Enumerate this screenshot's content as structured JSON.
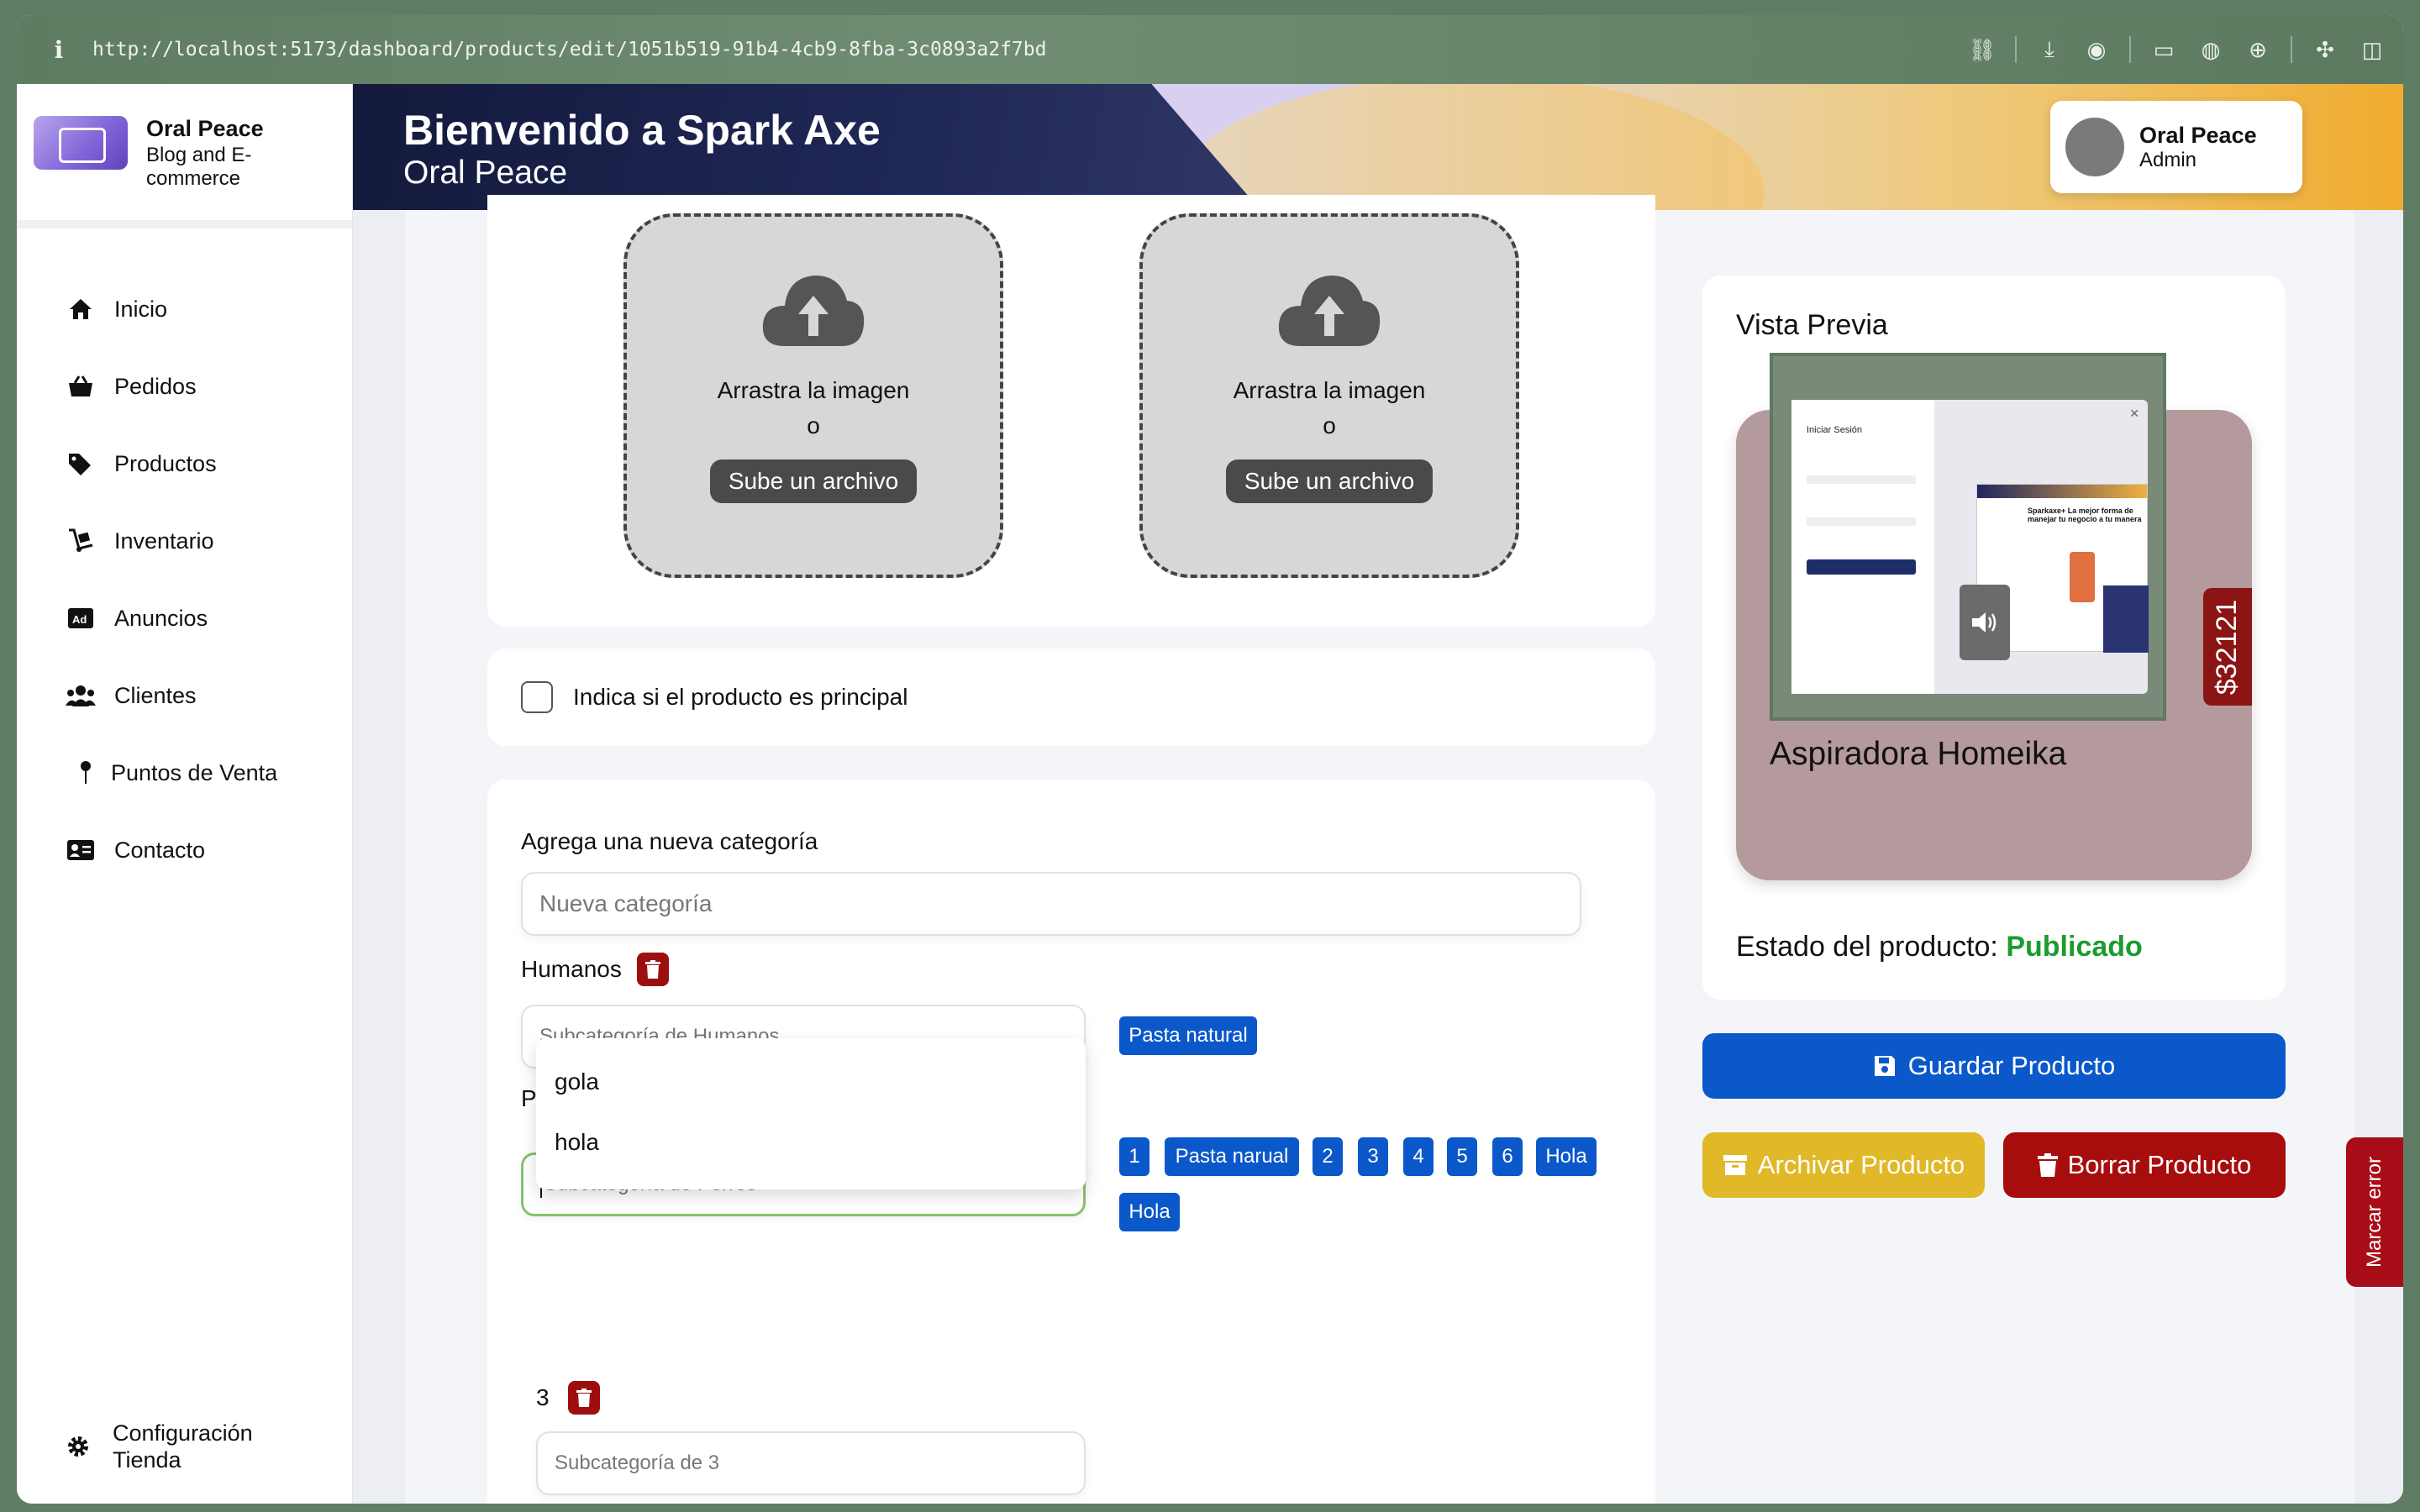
{
  "browser": {
    "url": "http://localhost:5173/dashboard/products/edit/1051b519-91b4-4cb9-8fba-3c0893a2f7bd"
  },
  "sidebar": {
    "brand_name": "Oral Peace",
    "brand_sub": "Blog and E-commerce",
    "items": [
      {
        "label": "Inicio",
        "icon": "home-icon"
      },
      {
        "label": "Pedidos",
        "icon": "basket-icon"
      },
      {
        "label": "Productos",
        "icon": "tags-icon"
      },
      {
        "label": "Inventario",
        "icon": "dolly-icon"
      },
      {
        "label": "Anuncios",
        "icon": "ad-icon"
      },
      {
        "label": "Clientes",
        "icon": "users-icon"
      },
      {
        "label": "Puntos de Venta",
        "icon": "pin-icon"
      },
      {
        "label": "Contacto",
        "icon": "contact-card-icon"
      }
    ],
    "config_label": "Configuración Tienda"
  },
  "header": {
    "title": "Bienvenido a Spark Axe",
    "subtitle": "Oral Peace",
    "user_name": "Oral Peace",
    "user_role": "Admin"
  },
  "uploads": [
    {
      "text1": "Arrastra la imagen",
      "text2": "o",
      "button": "Sube un archivo"
    },
    {
      "text1": "Arrastra la imagen",
      "text2": "o",
      "button": "Sube un archivo"
    }
  ],
  "principal": {
    "label": "Indica si el producto es principal",
    "checked": false
  },
  "categories": {
    "add_label": "Agrega una nueva categoría",
    "new_placeholder": "Nueva categoría",
    "groups": [
      {
        "name": "Humanos",
        "placeholder": "Subcategoría de Humanos",
        "subcategories": [
          "Pasta natural"
        ]
      },
      {
        "name": "Perros",
        "placeholder": "Subcategoría de Perros",
        "subcategories": [
          "1",
          "Pasta narual",
          "2",
          "3",
          "4",
          "5",
          "6",
          "Hola",
          "Hola"
        ]
      },
      {
        "name": "3",
        "placeholder": "Subcategoría de 3",
        "subcategories": []
      }
    ],
    "suggestions": [
      "gola",
      "hola"
    ]
  },
  "preview": {
    "title": "Vista Previa",
    "product_name": "Aspiradora Homeika",
    "price": "$32121",
    "status_label": "Estado del producto:",
    "status_value": "Publicado",
    "status_color": "#1a9c2e",
    "thumb_login_title": "Iniciar Sesión",
    "thumb_site_title": "Sparkaxe+ La mejor forma de manejar tu negocio a tu manera"
  },
  "actions": {
    "save": "Guardar Producto",
    "archive": "Archivar Producto",
    "delete": "Borrar Producto"
  },
  "flag_label": "Marcar error",
  "colors": {
    "primary": "#0a58ca",
    "danger": "#a80d0d",
    "warning": "#e1b827"
  }
}
